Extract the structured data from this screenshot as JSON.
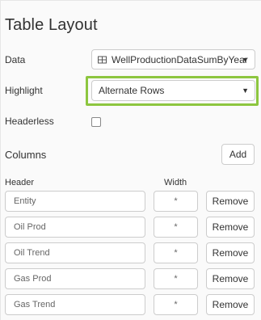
{
  "panel": {
    "title": "Table Layout"
  },
  "fields": {
    "data_label": "Data",
    "data_value": "WellProductionDataSumByYear",
    "data_icon": "table-icon",
    "highlight_label": "Highlight",
    "highlight_value": "Alternate Rows",
    "headerless_label": "Headerless",
    "headerless_checked": false
  },
  "columns": {
    "label": "Columns",
    "add_label": "Add",
    "header_col": "Header",
    "width_col": "Width",
    "remove_label": "Remove",
    "rows": [
      {
        "header": "Entity",
        "width": "*"
      },
      {
        "header": "Oil Prod",
        "width": "*"
      },
      {
        "header": "Oil Trend",
        "width": "*"
      },
      {
        "header": "Gas Prod",
        "width": "*"
      },
      {
        "header": "Gas Trend",
        "width": "*"
      }
    ]
  },
  "colors": {
    "highlight_ring": "#8dc63f",
    "border": "#cccccc"
  }
}
